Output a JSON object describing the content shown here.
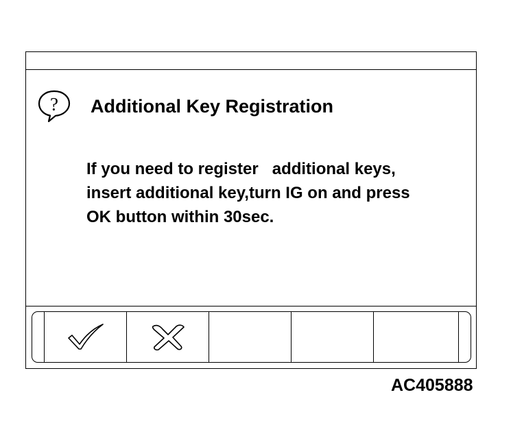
{
  "dialog": {
    "title": "Additional Key Registration",
    "icon": "help-question-icon",
    "message_lines": [
      "If you need to register   additional keys,",
      "insert additional key,turn IG on and press",
      "OK button within 30sec."
    ]
  },
  "softkeys": [
    {
      "icon": "checkmark-icon"
    },
    {
      "icon": "cross-icon"
    },
    {
      "icon": ""
    },
    {
      "icon": ""
    },
    {
      "icon": ""
    }
  ],
  "figure_code": "AC405888"
}
